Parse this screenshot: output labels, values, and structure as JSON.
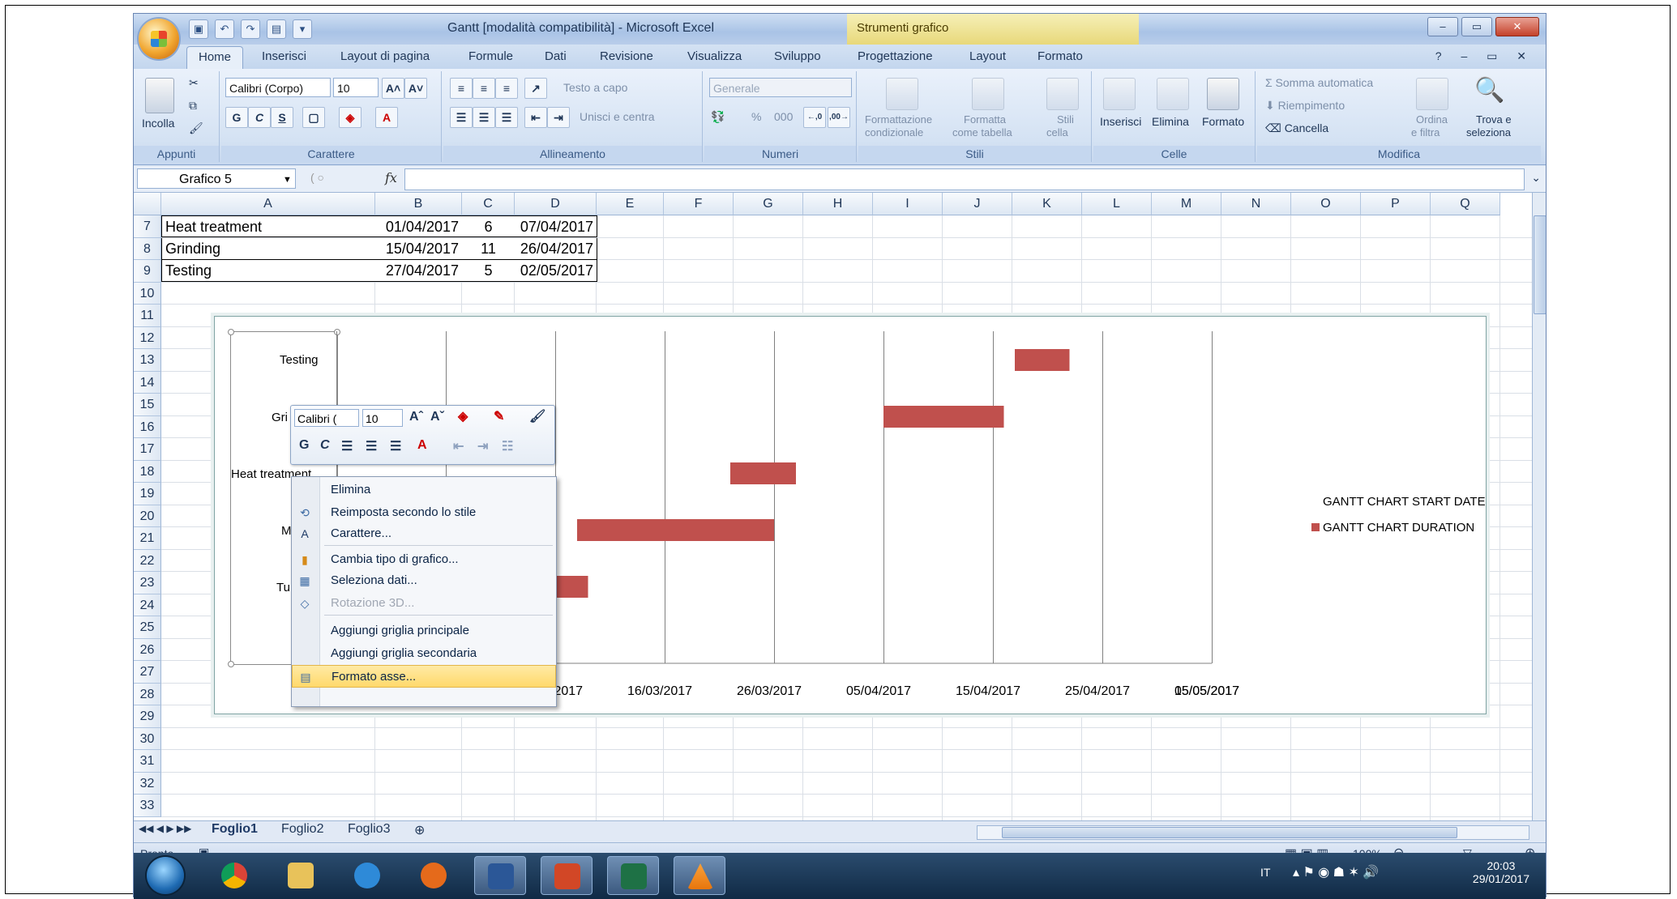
{
  "window": {
    "title": "Gantt  [modalità compatibilità] - Microsoft Excel",
    "context_tools": "Strumenti grafico"
  },
  "tabs": [
    "Home",
    "Inserisci",
    "Layout di pagina",
    "Formule",
    "Dati",
    "Revisione",
    "Visualizza",
    "Sviluppo",
    "Progettazione",
    "Layout",
    "Formato"
  ],
  "ribbon": {
    "appunti": {
      "label": "Appunti",
      "incolla": "Incolla"
    },
    "carattere": {
      "label": "Carattere",
      "font": "Calibri (Corpo)",
      "size": "10",
      "bold": "G",
      "italic": "C",
      "underline": "S"
    },
    "allineamento": {
      "label": "Allineamento",
      "wrap": "Testo a capo",
      "merge": "Unisci e centra"
    },
    "numeri": {
      "label": "Numeri",
      "format": "Generale",
      "percent": "%",
      "thousands": "000"
    },
    "stili": {
      "label": "Stili",
      "conditional_1": "Formattazione",
      "conditional_2": "condizionale",
      "as_table_1": "Formatta",
      "as_table_2": "come tabella",
      "cell_styles_1": "Stili",
      "cell_styles_2": "cella"
    },
    "celle": {
      "label": "Celle",
      "insert": "Inserisci",
      "delete": "Elimina",
      "format": "Formato"
    },
    "modifica": {
      "label": "Modifica",
      "autosum": "Somma automatica",
      "fill": "Riempimento",
      "clear": "Cancella",
      "sort_1": "Ordina",
      "sort_2": "e filtra",
      "find_1": "Trova e",
      "find_2": "seleziona"
    }
  },
  "formula_bar": {
    "name_box": "Grafico 5",
    "fx": "fx"
  },
  "columns": [
    "A",
    "B",
    "C",
    "D",
    "E",
    "F",
    "G",
    "H",
    "I",
    "J",
    "K",
    "L",
    "M",
    "N",
    "O",
    "P",
    "Q"
  ],
  "rows": [
    "7",
    "8",
    "9",
    "10",
    "11",
    "12",
    "13",
    "14",
    "15",
    "16",
    "17",
    "18",
    "19",
    "20",
    "21",
    "22",
    "23",
    "24",
    "25",
    "26",
    "27",
    "28",
    "29",
    "30",
    "31",
    "32",
    "33"
  ],
  "table": [
    [
      "Heat treatment",
      "01/04/2017",
      "6",
      "07/04/2017"
    ],
    [
      "Grinding",
      "15/04/2017",
      "11",
      "26/04/2017"
    ],
    [
      "Testing",
      "27/04/2017",
      "5",
      "02/05/2017"
    ]
  ],
  "chart_data": {
    "type": "bar",
    "orientation": "horizontal-stacked-gantt",
    "categories_visible": [
      "Testing",
      "Gri",
      "Heat treatment",
      "M",
      "Tu"
    ],
    "x_tick_labels": [
      "/02/2017",
      "06/03/2017",
      "16/03/2017",
      "26/03/2017",
      "05/04/2017",
      "15/04/2017",
      "25/04/2017",
      "05/05/2017",
      "15/05/2017"
    ],
    "series": [
      {
        "name": "GANTT CHART START DATE",
        "visible": false
      },
      {
        "name": "GANTT CHART DURATION",
        "color": "#c0504d",
        "bars": [
          {
            "row": 1,
            "start": "2017-04-27",
            "days": 5
          },
          {
            "row": 2,
            "start": "2017-04-15",
            "days": 11
          },
          {
            "row": 3,
            "start": "2017-04-01",
            "days": 6
          },
          {
            "row": 4,
            "start": "2017-03-18",
            "days": 18
          },
          {
            "row": 5,
            "start": "2017-03-04",
            "days": 15
          },
          {
            "row": 6,
            "start": "2017-03-01",
            "days": 6
          }
        ]
      }
    ],
    "x_axis": {
      "min": "2017-02-24",
      "max": "2017-05-15",
      "unit": "day",
      "major_unit_days": 10
    },
    "legend": {
      "position": "right",
      "entries": [
        "GANTT CHART START DATE",
        "GANTT CHART DURATION"
      ]
    },
    "grid": true
  },
  "mini_toolbar": {
    "font": "Calibri (",
    "size": "10",
    "bold": "G",
    "italic": "C"
  },
  "context_menu": [
    {
      "label": "Elimina",
      "icon": "",
      "enabled": true
    },
    {
      "label": "Reimposta secondo lo stile",
      "icon": "reset-style-icon",
      "enabled": true
    },
    {
      "label": "Carattere...",
      "icon": "font-icon",
      "enabled": true
    },
    {
      "label": "Cambia tipo di grafico...",
      "icon": "chart-type-icon",
      "enabled": true
    },
    {
      "label": "Seleziona dati...",
      "icon": "select-data-icon",
      "enabled": true
    },
    {
      "label": "Rotazione 3D...",
      "icon": "rotate-3d-icon",
      "enabled": false
    },
    {
      "label": "Aggiungi griglia principale",
      "icon": "",
      "enabled": true
    },
    {
      "label": "Aggiungi griglia secondaria",
      "icon": "",
      "enabled": true
    },
    {
      "label": "Formato asse...",
      "icon": "format-axis-icon",
      "enabled": true,
      "highlighted": true
    }
  ],
  "sheets": [
    "Foglio1",
    "Foglio2",
    "Foglio3"
  ],
  "status": {
    "ready": "Pronto",
    "zoom": "100%"
  },
  "taskbar": {
    "lang": "IT",
    "time": "20:03",
    "date": "29/01/2017"
  }
}
